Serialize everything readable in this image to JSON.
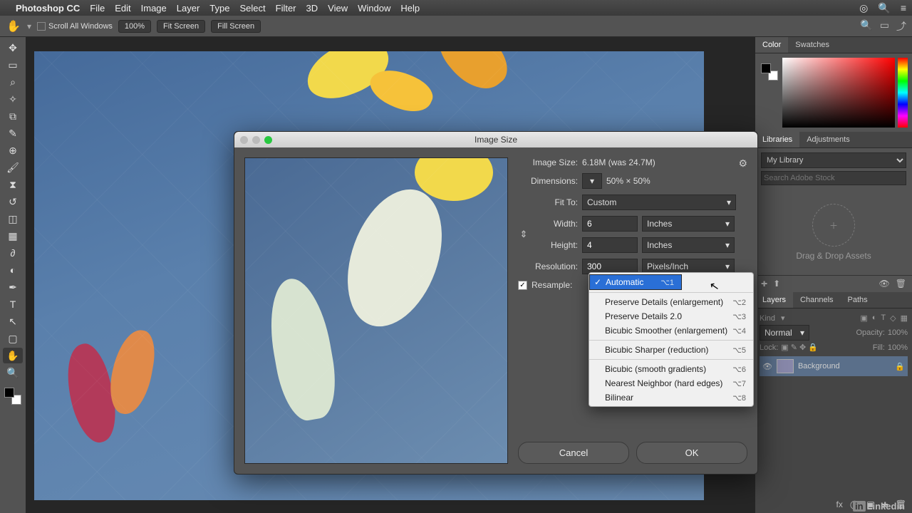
{
  "menubar": {
    "app": "Photoshop CC",
    "items": [
      "File",
      "Edit",
      "Image",
      "Layer",
      "Type",
      "Select",
      "Filter",
      "3D",
      "View",
      "Window",
      "Help"
    ]
  },
  "optbar": {
    "scroll_all": "Scroll All Windows",
    "zoom": "100%",
    "fit": "Fit Screen",
    "fill": "Fill Screen"
  },
  "panels": {
    "color_tab": "Color",
    "swatches_tab": "Swatches",
    "libraries_tab": "Libraries",
    "adjustments_tab": "Adjustments",
    "mylibrary": "My Library",
    "search_placeholder": "Search Adobe Stock",
    "dropzone": "Drag & Drop Assets",
    "layers_tab": "Layers",
    "channels_tab": "Channels",
    "paths_tab": "Paths",
    "kind": "Kind",
    "blend": "Normal",
    "opacity_lbl": "Opacity:",
    "opacity_val": "100%",
    "lock_lbl": "Lock:",
    "fill_lbl": "Fill:",
    "fill_val": "100%",
    "layer_name": "Background"
  },
  "dialog": {
    "title": "Image Size",
    "imgsize_lbl": "Image Size:",
    "imgsize_val": "6.18M (was 24.7M)",
    "dims_lbl": "Dimensions:",
    "dims_val": "50%  ×  50%",
    "fitto_lbl": "Fit To:",
    "fitto_val": "Custom",
    "width_lbl": "Width:",
    "width_val": "6",
    "width_unit": "Inches",
    "height_lbl": "Height:",
    "height_val": "4",
    "height_unit": "Inches",
    "res_lbl": "Resolution:",
    "res_val": "300",
    "res_unit": "Pixels/Inch",
    "resample_lbl": "Resample:",
    "cancel": "Cancel",
    "ok": "OK"
  },
  "dropdown": {
    "items": [
      {
        "label": "Automatic",
        "kb": "⌥1",
        "selected": true,
        "checked": true
      },
      {
        "sep": true
      },
      {
        "label": "Preserve Details (enlargement)",
        "kb": "⌥2"
      },
      {
        "label": "Preserve Details 2.0",
        "kb": "⌥3"
      },
      {
        "label": "Bicubic Smoother (enlargement)",
        "kb": "⌥4"
      },
      {
        "sep": true
      },
      {
        "label": "Bicubic Sharper (reduction)",
        "kb": "⌥5"
      },
      {
        "sep": true
      },
      {
        "label": "Bicubic (smooth gradients)",
        "kb": "⌥6"
      },
      {
        "label": "Nearest Neighbor (hard edges)",
        "kb": "⌥7"
      },
      {
        "label": "Bilinear",
        "kb": "⌥8"
      }
    ]
  },
  "brand": "Linkedin"
}
